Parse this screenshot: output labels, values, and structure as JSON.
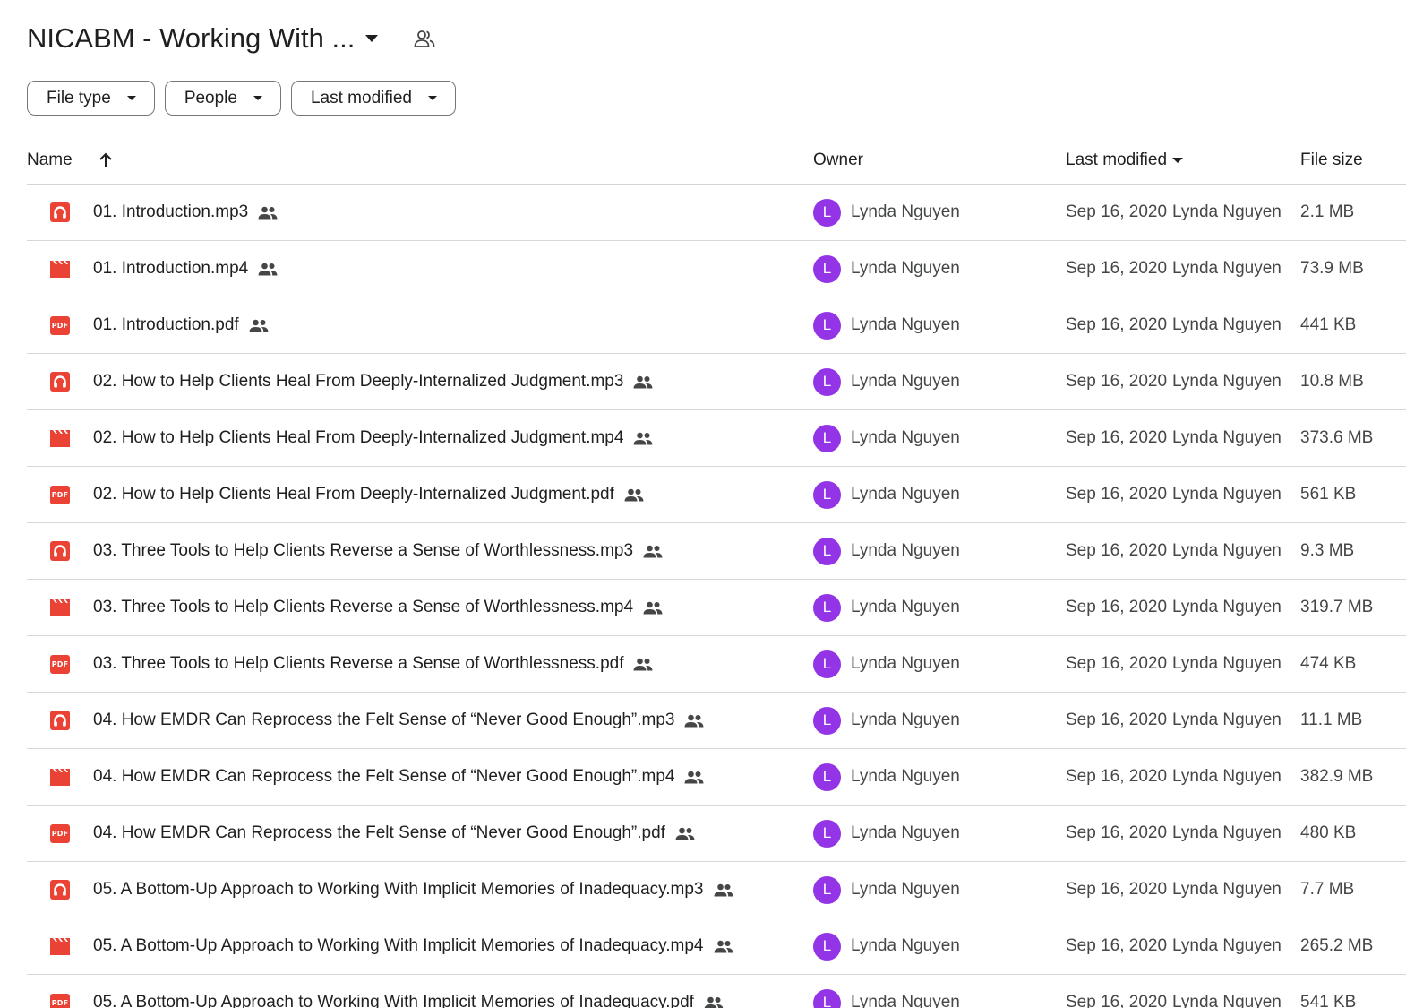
{
  "header": {
    "folder_title": "NICABM - Working With ...",
    "icons": {
      "dropdown": "caret-down-icon",
      "shared": "shared-people-icon"
    }
  },
  "filters": [
    {
      "label": "File type"
    },
    {
      "label": "People"
    },
    {
      "label": "Last modified"
    }
  ],
  "columns": {
    "name": "Name",
    "owner": "Owner",
    "last_modified": "Last modified",
    "file_size": "File size"
  },
  "colors": {
    "file_icon_red": "#ea4335",
    "avatar_purple": "#9334e6",
    "shared_icon": "#444746"
  },
  "files": [
    {
      "name": "01. Introduction.mp3",
      "type": "audio",
      "owner": "Lynda Nguyen",
      "owner_initial": "L",
      "modified_date": "Sep 16, 2020",
      "modified_by": "Lynda Nguyen",
      "size": "2.1 MB"
    },
    {
      "name": "01. Introduction.mp4",
      "type": "video",
      "owner": "Lynda Nguyen",
      "owner_initial": "L",
      "modified_date": "Sep 16, 2020",
      "modified_by": "Lynda Nguyen",
      "size": "73.9 MB"
    },
    {
      "name": "01. Introduction.pdf",
      "type": "pdf",
      "owner": "Lynda Nguyen",
      "owner_initial": "L",
      "modified_date": "Sep 16, 2020",
      "modified_by": "Lynda Nguyen",
      "size": "441 KB"
    },
    {
      "name": "02. How to Help Clients Heal From Deeply-Internalized Judgment.mp3",
      "type": "audio",
      "owner": "Lynda Nguyen",
      "owner_initial": "L",
      "modified_date": "Sep 16, 2020",
      "modified_by": "Lynda Nguyen",
      "size": "10.8 MB"
    },
    {
      "name": "02. How to Help Clients Heal From Deeply-Internalized Judgment.mp4",
      "type": "video",
      "owner": "Lynda Nguyen",
      "owner_initial": "L",
      "modified_date": "Sep 16, 2020",
      "modified_by": "Lynda Nguyen",
      "size": "373.6 MB"
    },
    {
      "name": "02. How to Help Clients Heal From Deeply-Internalized Judgment.pdf",
      "type": "pdf",
      "owner": "Lynda Nguyen",
      "owner_initial": "L",
      "modified_date": "Sep 16, 2020",
      "modified_by": "Lynda Nguyen",
      "size": "561 KB"
    },
    {
      "name": "03. Three Tools to Help Clients Reverse a Sense of Worthlessness.mp3",
      "type": "audio",
      "owner": "Lynda Nguyen",
      "owner_initial": "L",
      "modified_date": "Sep 16, 2020",
      "modified_by": "Lynda Nguyen",
      "size": "9.3 MB"
    },
    {
      "name": "03. Three Tools to Help Clients Reverse a Sense of Worthlessness.mp4",
      "type": "video",
      "owner": "Lynda Nguyen",
      "owner_initial": "L",
      "modified_date": "Sep 16, 2020",
      "modified_by": "Lynda Nguyen",
      "size": "319.7 MB"
    },
    {
      "name": "03. Three Tools to Help Clients Reverse a Sense of Worthlessness.pdf",
      "type": "pdf",
      "owner": "Lynda Nguyen",
      "owner_initial": "L",
      "modified_date": "Sep 16, 2020",
      "modified_by": "Lynda Nguyen",
      "size": "474 KB"
    },
    {
      "name": "04. How EMDR Can Reprocess the Felt Sense of “Never Good Enough”.mp3",
      "type": "audio",
      "owner": "Lynda Nguyen",
      "owner_initial": "L",
      "modified_date": "Sep 16, 2020",
      "modified_by": "Lynda Nguyen",
      "size": "11.1 MB"
    },
    {
      "name": "04. How EMDR Can Reprocess the Felt Sense of “Never Good Enough”.mp4",
      "type": "video",
      "owner": "Lynda Nguyen",
      "owner_initial": "L",
      "modified_date": "Sep 16, 2020",
      "modified_by": "Lynda Nguyen",
      "size": "382.9 MB"
    },
    {
      "name": "04. How EMDR Can Reprocess the Felt Sense of “Never Good Enough”.pdf",
      "type": "pdf",
      "owner": "Lynda Nguyen",
      "owner_initial": "L",
      "modified_date": "Sep 16, 2020",
      "modified_by": "Lynda Nguyen",
      "size": "480 KB"
    },
    {
      "name": "05. A Bottom-Up Approach to Working With Implicit Memories of Inadequacy.mp3",
      "type": "audio",
      "owner": "Lynda Nguyen",
      "owner_initial": "L",
      "modified_date": "Sep 16, 2020",
      "modified_by": "Lynda Nguyen",
      "size": "7.7 MB"
    },
    {
      "name": "05. A Bottom-Up Approach to Working With Implicit Memories of Inadequacy.mp4",
      "type": "video",
      "owner": "Lynda Nguyen",
      "owner_initial": "L",
      "modified_date": "Sep 16, 2020",
      "modified_by": "Lynda Nguyen",
      "size": "265.2 MB"
    },
    {
      "name": "05. A Bottom-Up Approach to Working With Implicit Memories of Inadequacy.pdf",
      "type": "pdf",
      "owner": "Lynda Nguyen",
      "owner_initial": "L",
      "modified_date": "Sep 16, 2020",
      "modified_by": "Lynda Nguyen",
      "size": "541 KB"
    }
  ],
  "icon_names": {
    "audio": "audio-file-icon",
    "video": "video-file-icon",
    "pdf": "pdf-file-icon",
    "pdf_badge_text": "PDF",
    "shared": "shared-icon"
  }
}
